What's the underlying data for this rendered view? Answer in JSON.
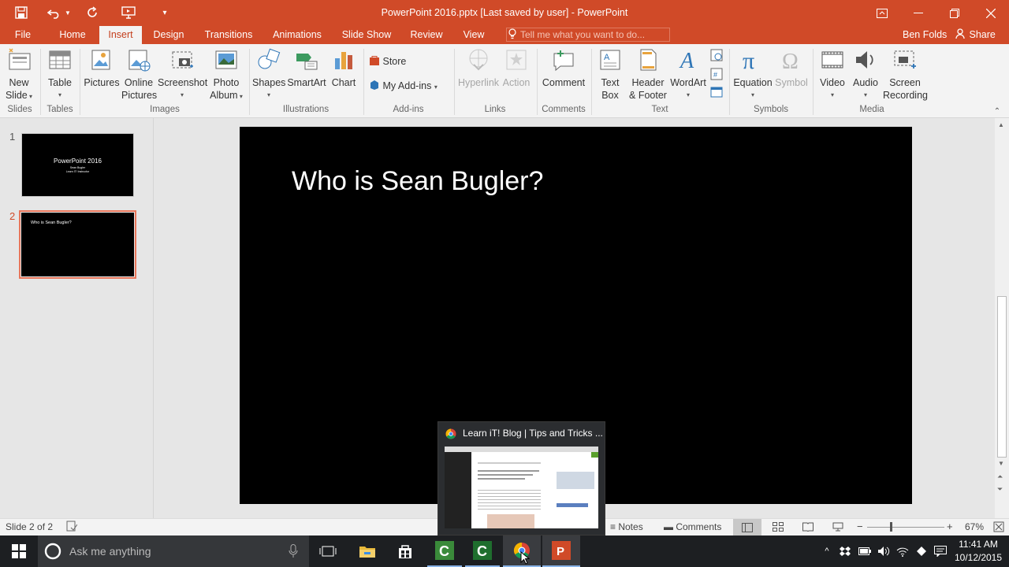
{
  "window": {
    "title": "PowerPoint 2016.pptx [Last saved by user] - PowerPoint"
  },
  "qat": {
    "save_icon": "save-icon",
    "undo_icon": "undo-icon",
    "redo_icon": "redo-icon",
    "present_icon": "present-from-beginning-icon"
  },
  "tabs": [
    "File",
    "Home",
    "Insert",
    "Design",
    "Transitions",
    "Animations",
    "Slide Show",
    "Review",
    "View"
  ],
  "tell_me": {
    "placeholder": "Tell me what you want to do..."
  },
  "user": {
    "name": "Ben Folds",
    "share": "Share"
  },
  "ribbon": {
    "slides": {
      "new_slide_1": "New",
      "new_slide_2": "Slide",
      "group": "Slides"
    },
    "tables": {
      "table": "Table",
      "group": "Tables"
    },
    "images": {
      "pictures": "Pictures",
      "online_1": "Online",
      "online_2": "Pictures",
      "screenshot": "Screenshot",
      "album_1": "Photo",
      "album_2": "Album",
      "group": "Images"
    },
    "illustrations": {
      "shapes": "Shapes",
      "smartart": "SmartArt",
      "chart": "Chart",
      "group": "Illustrations"
    },
    "addins": {
      "store": "Store",
      "my_addins": "My Add-ins",
      "group": "Add-ins"
    },
    "links": {
      "hyperlink": "Hyperlink",
      "action": "Action",
      "group": "Links"
    },
    "comments": {
      "comment": "Comment",
      "group": "Comments"
    },
    "text": {
      "textbox_1": "Text",
      "textbox_2": "Box",
      "hf_1": "Header",
      "hf_2": "& Footer",
      "wordart": "WordArt",
      "group": "Text"
    },
    "symbols": {
      "equation": "Equation",
      "symbol": "Symbol",
      "group": "Symbols"
    },
    "media": {
      "video": "Video",
      "audio": "Audio",
      "rec_1": "Screen",
      "rec_2": "Recording",
      "group": "Media"
    }
  },
  "thumbnails": [
    {
      "num": "1",
      "title": "PowerPoint 2016",
      "sub1": "Sean Bugler",
      "sub2": "Learn iT! Instructor"
    },
    {
      "num": "2",
      "title": "Who is Sean Bugler?"
    }
  ],
  "slide": {
    "title": "Who is Sean Bugler?"
  },
  "status": {
    "slide_of": "Slide 2 of 2",
    "notes": "Notes",
    "comments": "Comments",
    "zoom": "67%"
  },
  "taskbar": {
    "search": "Ask me anything",
    "time": "11:41 AM",
    "date": "10/12/2015"
  },
  "preview": {
    "title": "Learn iT! Blog | Tips and Tricks ..."
  },
  "colors": {
    "accent": "#d04a28",
    "slide_bg": "#000000",
    "taskbar": "#1d1f22"
  }
}
